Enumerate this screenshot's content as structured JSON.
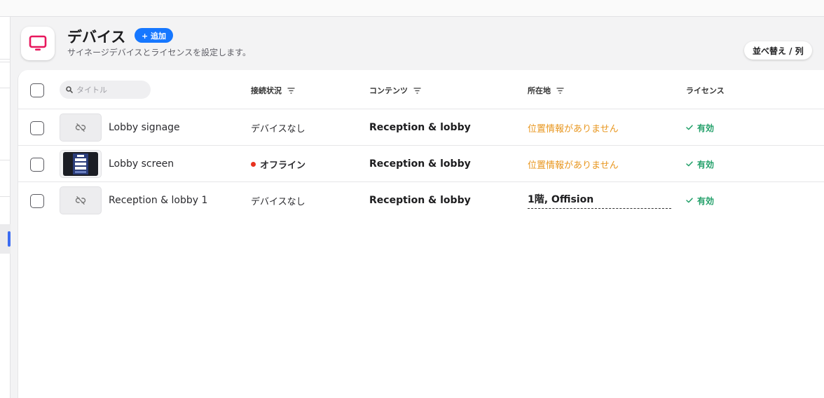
{
  "header": {
    "title": "デバイス",
    "add_label": "+ 追加",
    "subtitle": "サイネージデバイスとライセンスを設定します。",
    "sort_label": "並べ替え / 列"
  },
  "table": {
    "search_placeholder": "タイトル",
    "columns": {
      "status": "接続状況",
      "content": "コンテンツ",
      "location": "所在地",
      "license": "ライセンス"
    },
    "rows": [
      {
        "name": "Lobby signage",
        "status": "デバイスなし",
        "content": "Reception & lobby",
        "location": "位置情報がありません",
        "license": "有効"
      },
      {
        "name": "Lobby screen",
        "status": "オフライン",
        "content": "Reception & lobby",
        "location": "位置情報がありません",
        "license": "有効"
      },
      {
        "name": "Reception & lobby 1",
        "status": "デバイスなし",
        "content": "Reception & lobby",
        "location": "1階, Offision",
        "license": "有効"
      }
    ]
  },
  "colors": {
    "accent": "#1677ff",
    "brand_icon": "#e8175d",
    "offline": "#e8321f",
    "no_location": "#e8961e",
    "license_active": "#23a06a"
  },
  "icons": {
    "app": "monitor-icon",
    "search": "search-icon",
    "filter": "filter-icon",
    "unlinked": "unlink-icon",
    "check": "check-icon"
  }
}
